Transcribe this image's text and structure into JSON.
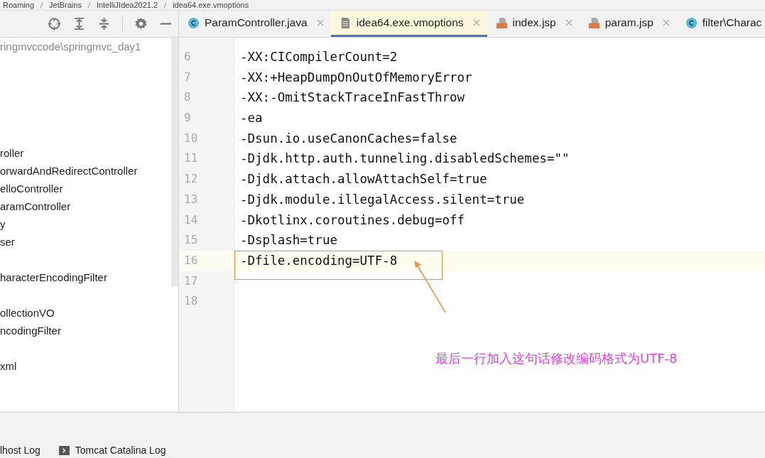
{
  "breadcrumbs": [
    "Roaming",
    "JetBrains",
    "IntelliJIdea2021.2",
    "idea64.exe.vmoptions"
  ],
  "project_tree": {
    "path": "ringmvccode\\springmvc_day1",
    "items": [
      {
        "label": "roller"
      },
      {
        "label": "orwardAndRedirectController"
      },
      {
        "label": "elloController"
      },
      {
        "label": "aramController"
      },
      {
        "label": "y"
      },
      {
        "label": "ser"
      },
      {
        "label": "haracterEncodingFilter"
      },
      {
        "label": "ollectionVO"
      },
      {
        "label": "ncodingFilter"
      },
      {
        "label": "xml"
      }
    ]
  },
  "tabs": [
    {
      "label": "ParamController.java",
      "kind": "class",
      "selected": false,
      "closable": true
    },
    {
      "label": "idea64.exe.vmoptions",
      "kind": "text",
      "selected": true,
      "closable": true
    },
    {
      "label": "index.jsp",
      "kind": "jsp",
      "selected": false,
      "closable": true
    },
    {
      "label": "param.jsp",
      "kind": "jsp",
      "selected": false,
      "closable": true
    },
    {
      "label": "filter\\Charac",
      "kind": "class",
      "selected": false,
      "closable": false
    }
  ],
  "editor": {
    "lines": [
      {
        "number": "6",
        "text": "-XX:CICompilerCount=2",
        "current": false
      },
      {
        "number": "7",
        "text": "-XX:+HeapDumpOnOutOfMemoryError",
        "current": false
      },
      {
        "number": "8",
        "text": "-XX:-OmitStackTraceInFastThrow",
        "current": false
      },
      {
        "number": "9",
        "text": "-ea",
        "current": false
      },
      {
        "number": "10",
        "text": "-Dsun.io.useCanonCaches=false",
        "current": false
      },
      {
        "number": "11",
        "text": "-Djdk.http.auth.tunneling.disabledSchemes=\"\"",
        "current": false
      },
      {
        "number": "12",
        "text": "-Djdk.attach.allowAttachSelf=true",
        "current": false
      },
      {
        "number": "13",
        "text": "-Djdk.module.illegalAccess.silent=true",
        "current": false
      },
      {
        "number": "14",
        "text": "-Dkotlinx.coroutines.debug=off",
        "current": false
      },
      {
        "number": "15",
        "text": "-Dsplash=true",
        "current": false
      },
      {
        "number": "16",
        "text": "-Dfile.encoding=UTF-8",
        "current": true
      },
      {
        "number": "17",
        "current": false
      },
      {
        "number": "18",
        "current": false
      }
    ],
    "annotation": "最后一行加入这句话修改编码格式为UTF-8"
  },
  "bottom_tabs": [
    {
      "label": "lhost Log",
      "icon": false
    },
    {
      "label": "Tomcat Catalina Log",
      "icon": true
    }
  ]
}
